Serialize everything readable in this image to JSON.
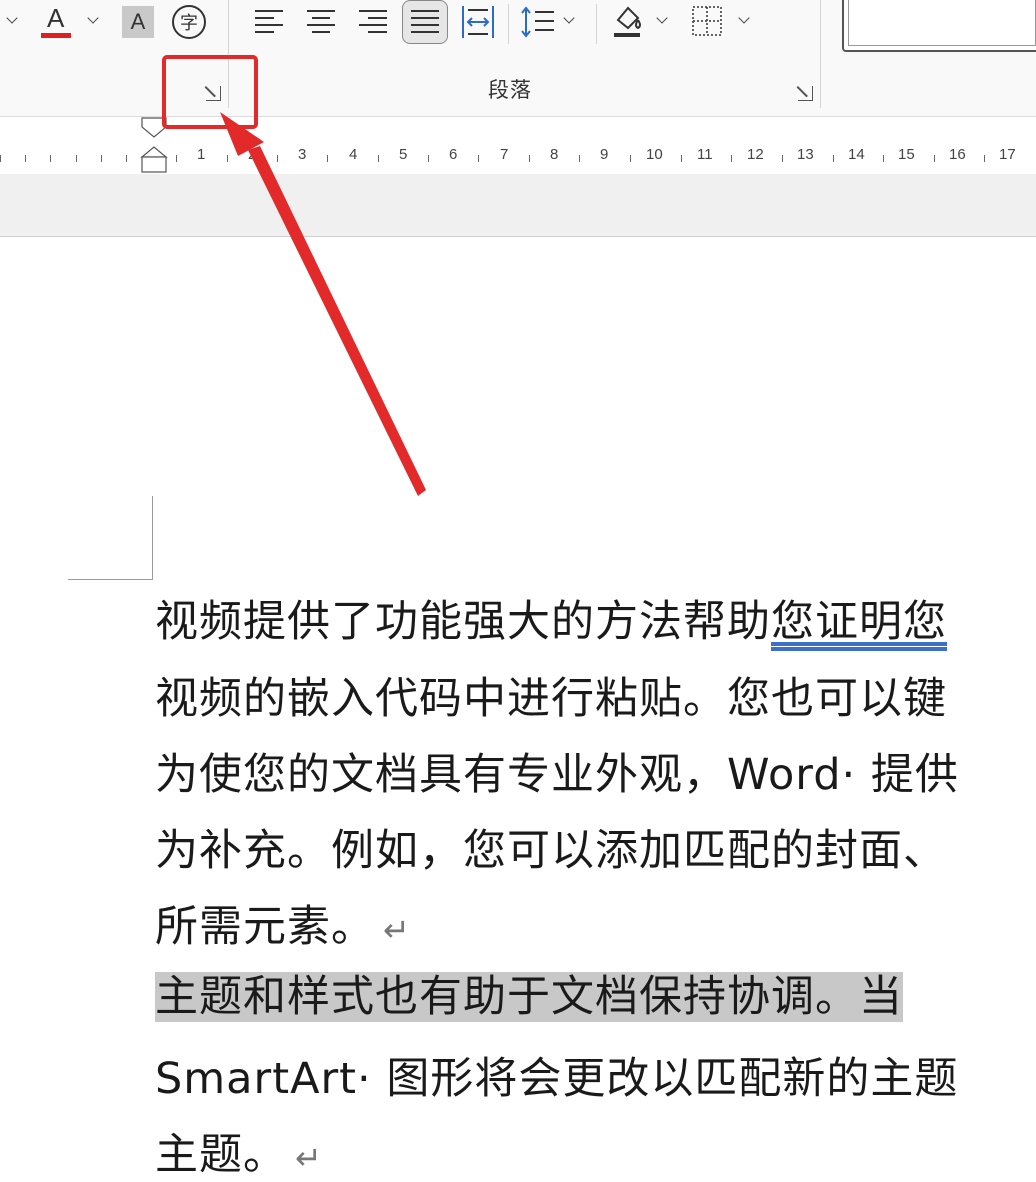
{
  "ribbon": {
    "font_color_glyph": "A",
    "font_color_accent": "#e02020",
    "char_shading_glyph": "A",
    "phonetic_guide_glyph": "字",
    "paragraph_group_label": "段落"
  },
  "ruler": {
    "labels": [
      "1",
      "2",
      "3",
      "4",
      "5",
      "6",
      "7",
      "8",
      "9",
      "10",
      "11",
      "12",
      "13",
      "14",
      "15",
      "16",
      "17"
    ]
  },
  "annotation": {
    "color": "#e22a2a"
  },
  "document": {
    "lines": [
      "视频提供了功能强大的方法帮助",
      "视频的嵌入代码中进行粘贴。您也可以键",
      "为使您的文档具有专业外观，Word· 提供",
      "为补充。例如，您可以添加匹配的封面、",
      "所需元素。",
      "主题和样式也有助于文档保持协调。当",
      "SmartArt· 图形将会更改以匹配新的主题",
      "主题。"
    ],
    "line1_underlined": "您证明您",
    "highlight_color": "#c8c8c8",
    "paragraph_mark": "↵"
  }
}
